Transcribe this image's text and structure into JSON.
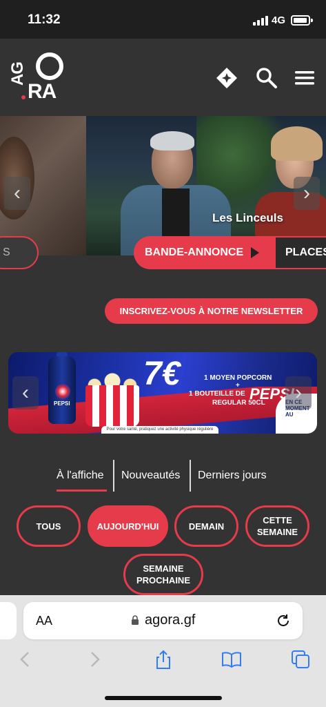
{
  "status_bar": {
    "time": "11:32",
    "network": "4G"
  },
  "header": {
    "logo_line1": "AG",
    "logo_line2": "RA",
    "icons": [
      "ticket-icon",
      "search-icon",
      "menu-icon"
    ]
  },
  "hero": {
    "title": "Les Linceuls",
    "trailer_label": "BANDE-ANNONCE",
    "places_label": "PLACES",
    "left_fragment": "S"
  },
  "newsletter": {
    "label": "INSCRIVEZ-VOUS À NOTRE NEWSLETTER"
  },
  "ad": {
    "price": "7€",
    "line1": "1 MOYEN POPCORN",
    "plus": "+",
    "line2": "1 BOUTEILLE DE",
    "brand": "PEPSI",
    "line3": "REGULAR 50CL",
    "bottle_label": "PEPSI",
    "disclaimer": "Pour votre santé, pratiquez une activité physique régulière",
    "badge_line1": "EN CE",
    "badge_line2": "MOMENT",
    "badge_line3": "AU"
  },
  "tabs": [
    {
      "label": "À l'affiche",
      "active": true
    },
    {
      "label": "Nouveautés",
      "active": false
    },
    {
      "label": "Derniers jours",
      "active": false
    }
  ],
  "filters": [
    {
      "label": "TOUS",
      "active": false
    },
    {
      "label": "AUJOURD'HUI",
      "active": true
    },
    {
      "label": "DEMAIN",
      "active": false
    },
    {
      "label": "CETTE SEMAINE",
      "active": false
    },
    {
      "label": "SEMAINE PROCHAINE",
      "active": false
    }
  ],
  "browser": {
    "aa_label": "AA",
    "url": "agora.gf"
  },
  "colors": {
    "accent": "#e63b4a",
    "background": "#333333"
  }
}
